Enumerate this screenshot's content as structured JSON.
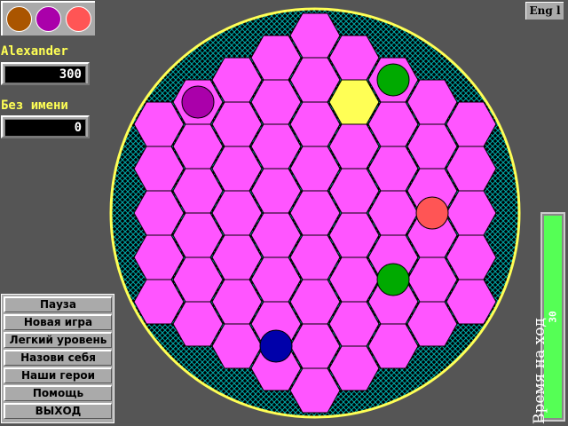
{
  "palette": [
    {
      "color": "#aa5500"
    },
    {
      "color": "#aa00aa"
    },
    {
      "color": "#ff5555"
    }
  ],
  "players": [
    {
      "name": "Alexander",
      "score": "300"
    },
    {
      "name": "Без имени",
      "score": "0"
    }
  ],
  "menu": [
    "Пауза",
    "Новая игра",
    "Легкий уровень",
    "Назови себя",
    "Наши герои",
    "Помощь",
    "ВЫХОД"
  ],
  "language_button": "Eng l",
  "timer": {
    "label": "Время на ход",
    "value": "30",
    "fraction": 1.0
  },
  "board": {
    "hex_color": "#ff55ff",
    "selected_color": "#ffff55",
    "border_color": "#ffff55",
    "hatch_color": "#00aaaa",
    "selected": {
      "col": 1,
      "row": "upper-2"
    },
    "pieces": [
      {
        "col": 2,
        "y": 3,
        "color": "#00aa00"
      },
      {
        "col": -3,
        "y": 4,
        "color": "#aa00aa"
      },
      {
        "col": 3,
        "y": 9,
        "color": "#ff5555"
      },
      {
        "col": 2,
        "y": 12,
        "color": "#00aa00"
      },
      {
        "col": -1,
        "y": 15,
        "color": "#0000aa"
      }
    ]
  }
}
